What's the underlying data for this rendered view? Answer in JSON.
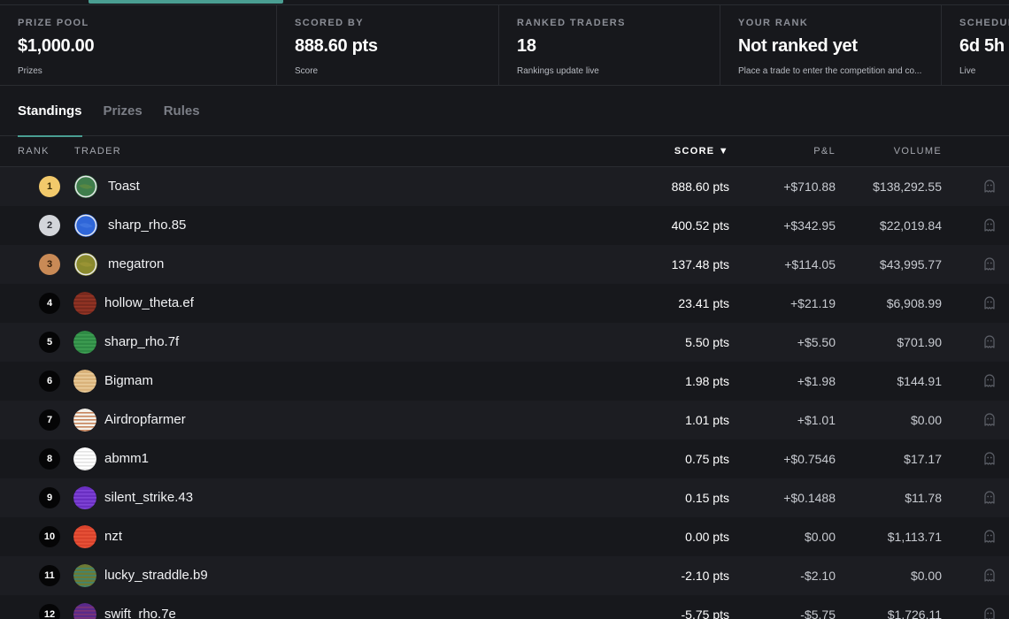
{
  "stats": [
    {
      "label": "PRIZE POOL",
      "value": "$1,000.00",
      "sub": "Prizes"
    },
    {
      "label": "SCORED BY",
      "value": "888.60 pts",
      "sub": "Score"
    },
    {
      "label": "RANKED TRADERS",
      "value": "18",
      "sub": "Rankings update live"
    },
    {
      "label": "YOUR RANK",
      "value": "Not ranked yet",
      "sub": "Place a trade to enter the competition and co..."
    },
    {
      "label": "SCHEDULE",
      "value": "6d 5h",
      "sub": "Live"
    }
  ],
  "tabs": [
    {
      "label": "Standings",
      "active": true
    },
    {
      "label": "Prizes",
      "active": false
    },
    {
      "label": "Rules",
      "active": false
    }
  ],
  "table": {
    "headers": {
      "rank": "RANK",
      "trader": "TRADER",
      "score": "SCORE ▼",
      "pnl": "P&L",
      "volume": "VOLUME"
    },
    "rows": [
      {
        "rank": "1",
        "name": "Toast",
        "score": "888.60 pts",
        "pnl": "+$710.88",
        "volume": "$138,292.55",
        "medal": "gold",
        "avatar": {
          "colors": [
            "#3f7d4c",
            "#6e8f3a"
          ]
        }
      },
      {
        "rank": "2",
        "name": "sharp_rho.85",
        "score": "400.52 pts",
        "pnl": "+$342.95",
        "volume": "$22,019.84",
        "medal": "silver",
        "avatar": {
          "colors": [
            "#2f66d8",
            "#4a7fe6"
          ]
        }
      },
      {
        "rank": "3",
        "name": "megatron",
        "score": "137.48 pts",
        "pnl": "+$114.05",
        "volume": "$43,995.77",
        "medal": "bronze",
        "avatar": {
          "colors": [
            "#8a8a2e",
            "#a59a3a"
          ]
        }
      },
      {
        "rank": "4",
        "name": "hollow_theta.ef",
        "score": "23.41 pts",
        "pnl": "+$21.19",
        "volume": "$6,908.99",
        "medal": "",
        "avatar": {
          "colors": [
            "#7a2a1e",
            "#a23b28"
          ]
        }
      },
      {
        "rank": "5",
        "name": "sharp_rho.7f",
        "score": "5.50 pts",
        "pnl": "+$5.50",
        "volume": "$701.90",
        "medal": "",
        "avatar": {
          "colors": [
            "#2f8a45",
            "#45a85a"
          ]
        }
      },
      {
        "rank": "6",
        "name": "Bigmam",
        "score": "1.98 pts",
        "pnl": "+$1.98",
        "volume": "$144.91",
        "medal": "",
        "avatar": {
          "colors": [
            "#d9b27a",
            "#f0d6a8"
          ]
        }
      },
      {
        "rank": "7",
        "name": "Airdropfarmer",
        "score": "1.01 pts",
        "pnl": "+$1.01",
        "volume": "$0.00",
        "medal": "",
        "avatar": {
          "colors": [
            "#f4f1ea",
            "#b4561f"
          ]
        }
      },
      {
        "rank": "8",
        "name": "abmm1",
        "score": "0.75 pts",
        "pnl": "+$0.7546",
        "volume": "$17.17",
        "medal": "",
        "avatar": {
          "colors": [
            "#ffffff",
            "#d8d8d8"
          ]
        }
      },
      {
        "rank": "9",
        "name": "silent_strike.43",
        "score": "0.15 pts",
        "pnl": "+$0.1488",
        "volume": "$11.78",
        "medal": "",
        "avatar": {
          "colors": [
            "#6a2fc2",
            "#8a4ee0"
          ]
        }
      },
      {
        "rank": "10",
        "name": "nzt",
        "score": "0.00 pts",
        "pnl": "$0.00",
        "volume": "$1,113.71",
        "medal": "",
        "avatar": {
          "colors": [
            "#d9432c",
            "#ee5a3e"
          ]
        }
      },
      {
        "rank": "11",
        "name": "lucky_straddle.b9",
        "score": "-2.10 pts",
        "pnl": "-$2.10",
        "volume": "$0.00",
        "medal": "",
        "avatar": {
          "colors": [
            "#6d7a35",
            "#2e8a8a"
          ]
        }
      },
      {
        "rank": "12",
        "name": "swift_rho.7e",
        "score": "-5.75 pts",
        "pnl": "-$5.75",
        "volume": "$1,726.11",
        "medal": "",
        "avatar": {
          "colors": [
            "#5a2a8a",
            "#8a3a6e"
          ]
        }
      }
    ]
  }
}
